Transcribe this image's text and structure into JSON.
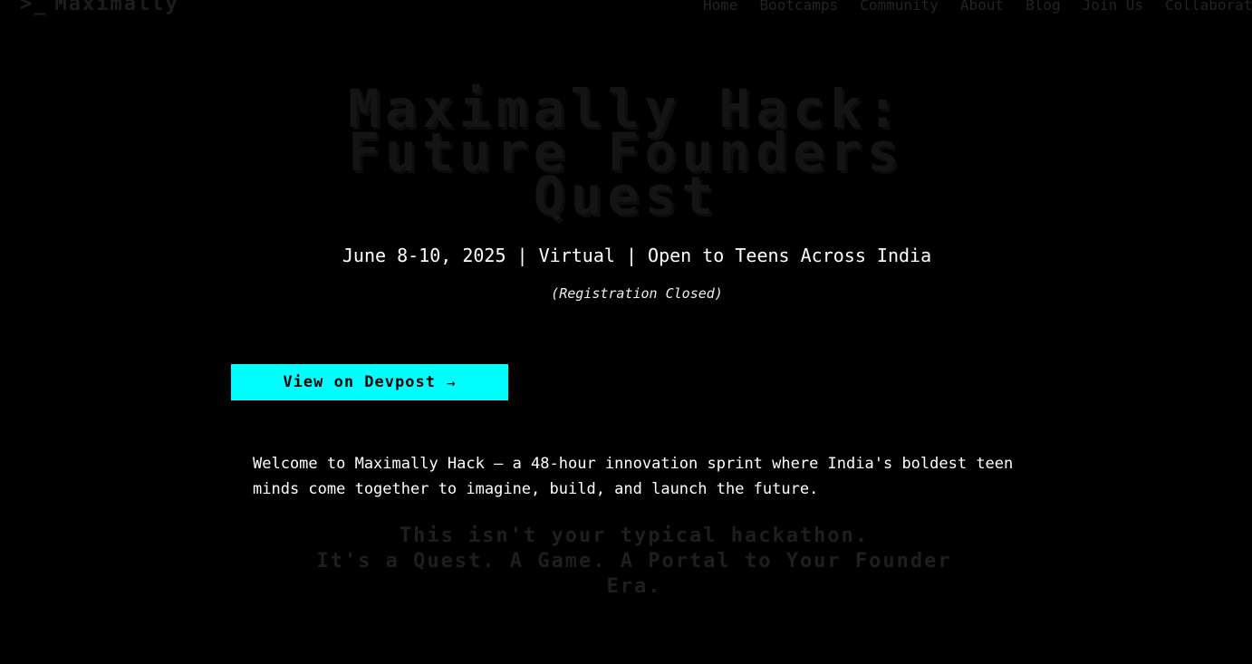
{
  "nav": {
    "logo_prompt": ">_",
    "logo_text": "Maximally",
    "links": [
      "Home",
      "Bootcamps",
      "Community",
      "About",
      "Blog",
      "Join Us",
      "Collaborate"
    ]
  },
  "hero": {
    "title_lines": [
      "Maximally Hack:",
      "Future Founders",
      "Quest"
    ],
    "event_info": "June 8-10, 2025 | Virtual | Open to Teens Across India",
    "registration_status": "(Registration Closed)"
  },
  "cta": {
    "label": "View on Devpost",
    "arrow": "→"
  },
  "welcome_text": "Welcome to Maximally Hack — a 48-hour innovation sprint where India's boldest teen minds come together to imagine, build, and launch the future.",
  "tagline_lines": [
    "This isn't your typical hackathon.",
    "It's a Quest. A Game. A Portal to Your Founder",
    "Era."
  ],
  "colors": {
    "background": "#000000",
    "accent": "#00ffff",
    "text": "#ffffff",
    "dim_text": "#1e1e1e"
  }
}
